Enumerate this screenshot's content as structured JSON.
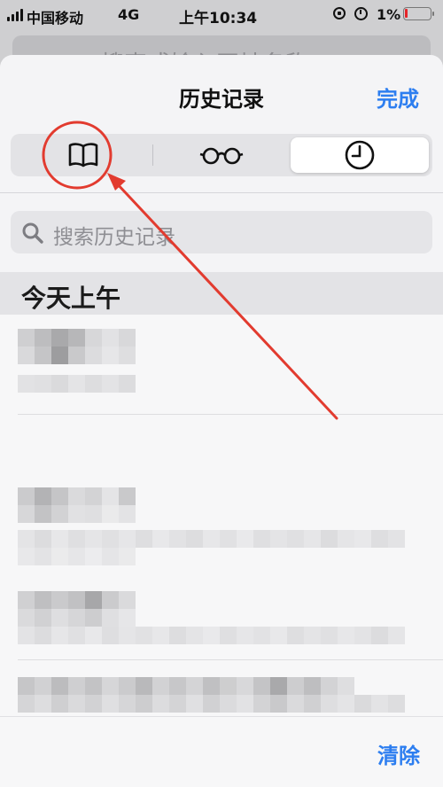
{
  "status_bar": {
    "carrier": "中国移动",
    "network": "4G",
    "time": "上午10:34",
    "battery_percent": "1%",
    "battery_level": 0.1
  },
  "background": {
    "search_hint": "搜索或输入网址名称"
  },
  "sheet": {
    "title": "历史记录",
    "done_label": "完成",
    "segments": [
      {
        "icon": "book-icon",
        "selected": false
      },
      {
        "icon": "glasses-icon",
        "selected": false
      },
      {
        "icon": "clock-icon",
        "selected": true
      }
    ],
    "search": {
      "placeholder": "搜索历史记录"
    },
    "section_title": "今天上午",
    "clear_label": "清除"
  },
  "colors": {
    "accent": "#2d7ef0",
    "annotation": "#e23b2f"
  }
}
